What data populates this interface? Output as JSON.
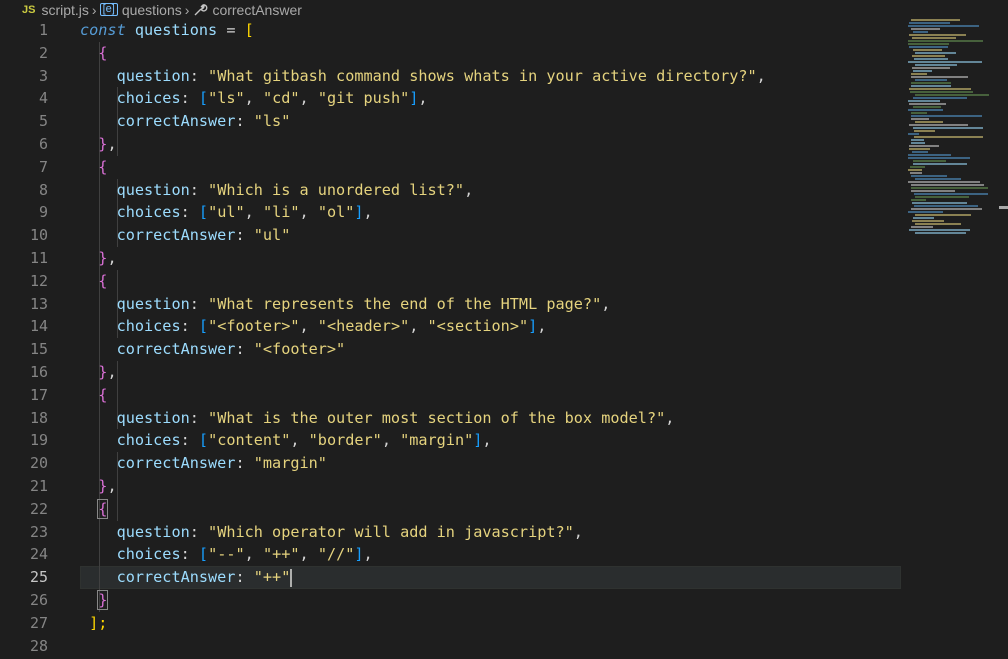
{
  "breadcrumb": {
    "file_icon": "JS",
    "file": "script.js",
    "symbol1": "questions",
    "symbol2": "correctAnswer"
  },
  "code": {
    "line_numbers": [
      "1",
      "2",
      "3",
      "4",
      "5",
      "6",
      "7",
      "8",
      "9",
      "10",
      "11",
      "12",
      "13",
      "14",
      "15",
      "16",
      "17",
      "18",
      "19",
      "20",
      "21",
      "22",
      "23",
      "24",
      "25",
      "26",
      "27",
      "28"
    ],
    "decl_keyword": "const",
    "var_name": "questions",
    "eq": "=",
    "open_bracket": "[",
    "close": "];",
    "keys": {
      "question": "question",
      "choices": "choices",
      "correct": "correctAnswer"
    },
    "items": [
      {
        "question": "\"What gitbash command shows whats in your active directory?\"",
        "choices": [
          "\"ls\"",
          "\"cd\"",
          "\"git push\""
        ],
        "answer": "\"ls\""
      },
      {
        "question": "\"Which is a unordered list?\"",
        "choices": [
          "\"ul\"",
          "\"li\"",
          "\"ol\""
        ],
        "answer": "\"ul\""
      },
      {
        "question": "\"What represents the end of the HTML page?\"",
        "choices": [
          "\"<footer>\"",
          "\"<header>\"",
          "\"<section>\""
        ],
        "answer": "\"<footer>\""
      },
      {
        "question": "\"What is the outer most section of the box model?\"",
        "choices": [
          "\"content\"",
          "\"border\"",
          "\"margin\""
        ],
        "answer": "\"margin\""
      },
      {
        "question": "\"Which operator will add in javascript?\"",
        "choices": [
          "\"--\"",
          "\"++\"",
          "\"//\""
        ],
        "answer": "\"++\""
      }
    ]
  },
  "editor": {
    "active_line": "25"
  },
  "colors": {
    "background": "#1e1e1e",
    "string": "#e5d37e",
    "keyword": "#569cd6",
    "variable": "#9cdcfe"
  }
}
